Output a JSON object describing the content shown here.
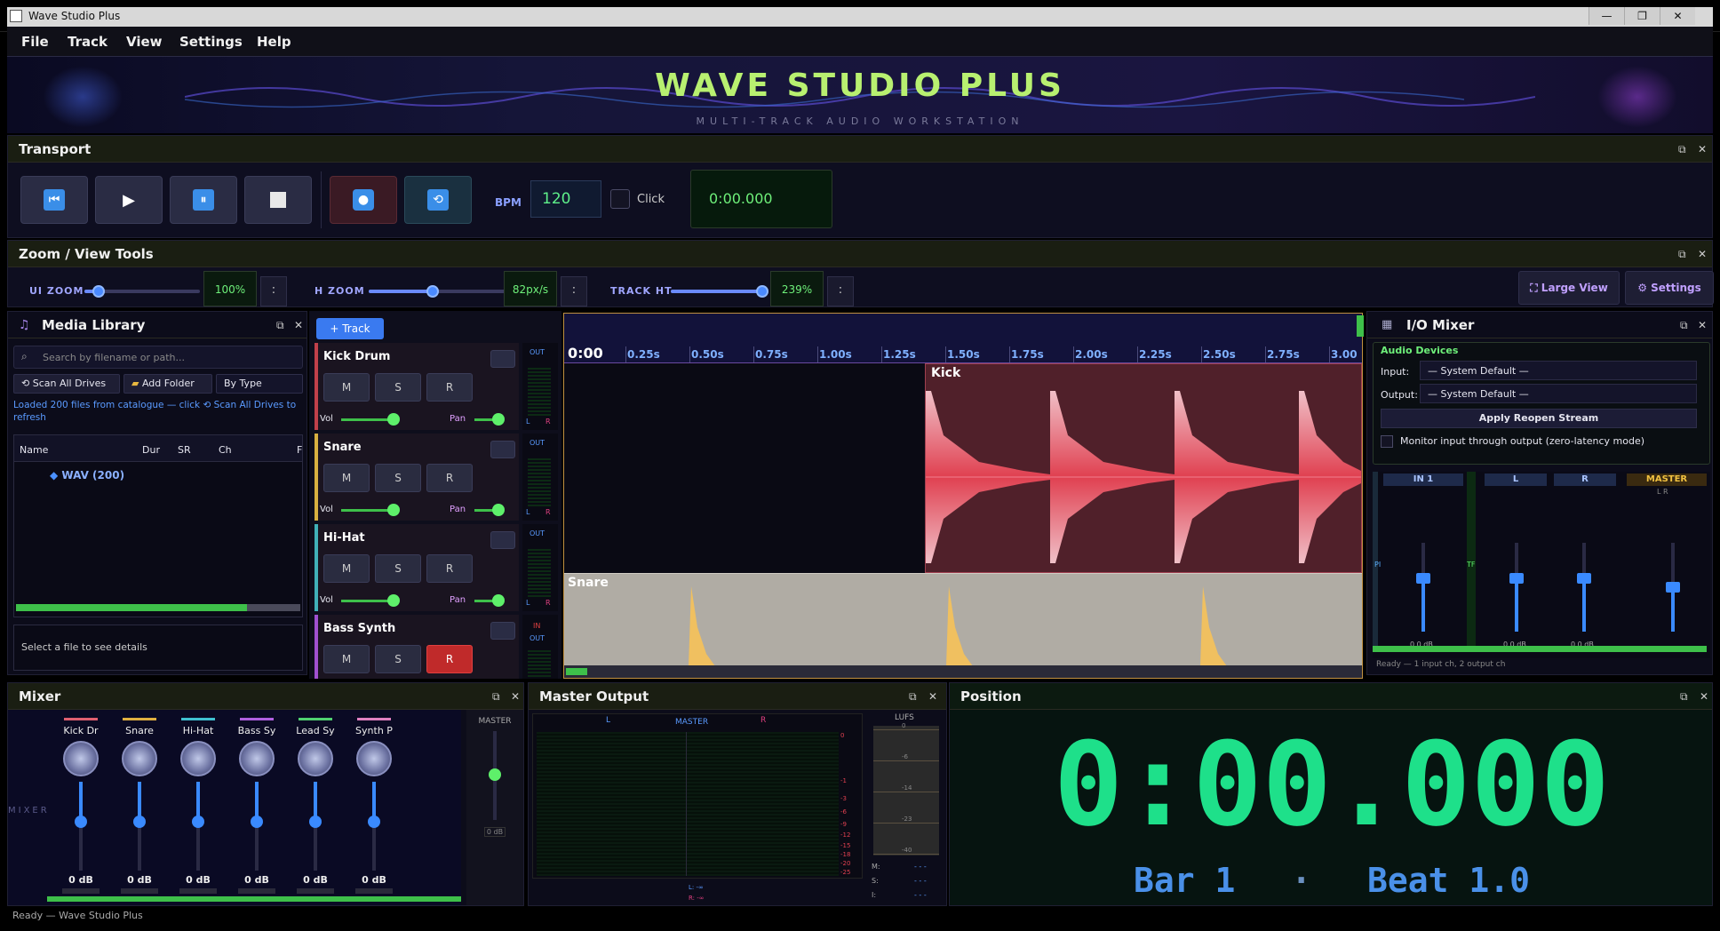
{
  "window": {
    "title": "Wave Studio Plus",
    "controls": [
      "—",
      "❐",
      "✕"
    ]
  },
  "menu": [
    "File",
    "Track",
    "View",
    "Settings",
    "Help"
  ],
  "banner": {
    "title": "WAVE STUDIO PLUS",
    "subtitle": "MULTI-TRACK AUDIO WORKSTATION"
  },
  "transport": {
    "title": "Transport",
    "bpm_label": "BPM",
    "bpm": "120",
    "click_label": "Click",
    "time": "0:00.000"
  },
  "zoom": {
    "title": "Zoom / View Tools",
    "ui_zoom_label": "UI ZOOM",
    "ui_zoom_value": "100%",
    "ui_zoom_level": 0.12,
    "h_zoom_label": "H ZOOM",
    "h_zoom_value": "82px/s",
    "h_zoom_level": 0.45,
    "track_ht_label": "TRACK HT",
    "track_ht_value": "239%",
    "track_ht_level": 0.95,
    "dots": ":",
    "large_view": "Large View",
    "settings": "Settings"
  },
  "media": {
    "title": "Media Library",
    "search_placeholder": "Search by filename or path...",
    "scan_all": "Scan All Drives",
    "add_folder": "Add Folder",
    "sort": "By Type",
    "info": "Loaded 200 files from catalogue — click ⟲ Scan All Drives to refresh",
    "columns": [
      "Name",
      "Dur",
      "SR",
      "Ch",
      "F"
    ],
    "tree_item": "WAV  (200)",
    "details": "Select a file to see details"
  },
  "tracks": {
    "add_track": "+ Track",
    "out": "OUT",
    "in": "IN",
    "items": [
      {
        "name": "Kick Drum",
        "m": "M",
        "s": "S",
        "r": "R",
        "vol": "Vol",
        "pan": "Pan",
        "color": "#c0404a"
      },
      {
        "name": "Snare",
        "m": "M",
        "s": "S",
        "r": "R",
        "vol": "Vol",
        "pan": "Pan",
        "color": "#d8b040"
      },
      {
        "name": "Hi-Hat",
        "m": "M",
        "s": "S",
        "r": "R",
        "vol": "Vol",
        "pan": "Pan",
        "color": "#40b0b8"
      },
      {
        "name": "Bass Synth",
        "m": "M",
        "s": "S",
        "r": "R",
        "vol": "",
        "pan": "",
        "color": "#a050d0"
      }
    ]
  },
  "timeline": {
    "ticks": [
      "0:00",
      "0.25s",
      "0.50s",
      "0.75s",
      "1.00s",
      "1.25s",
      "1.50s",
      "1.75s",
      "2.00s",
      "2.25s",
      "2.50s",
      "2.75s",
      "3.00"
    ],
    "clip_kick": "Kick",
    "clip_snare": "Snare"
  },
  "io_mixer": {
    "title": "I/O Mixer",
    "audio_devices": "Audio Devices",
    "input_label": "Input:",
    "input_value": "— System Default —",
    "output_label": "Output:",
    "output_value": "— System Default —",
    "apply": "Apply  Reopen Stream",
    "monitor": "Monitor input through output (zero-latency mode)",
    "channels": [
      "IN 1",
      "L",
      "R",
      "MASTER"
    ],
    "db": "0.0 dB",
    "status": "Ready — 1 input ch, 2 output ch",
    "lr": "L  R"
  },
  "mixer": {
    "title": "Mixer",
    "side": "MIXER",
    "master": "MASTER",
    "master_db": "0 dB",
    "strips": [
      {
        "name": "Kick Dr",
        "db": "0 dB",
        "color": "#e06070"
      },
      {
        "name": "Snare",
        "db": "0 dB",
        "color": "#e0b040"
      },
      {
        "name": "Hi-Hat",
        "db": "0 dB",
        "color": "#40c0d0"
      },
      {
        "name": "Bass Sy",
        "db": "0 dB",
        "color": "#b060e0"
      },
      {
        "name": "Lead Sy",
        "db": "0 dB",
        "color": "#50d070"
      },
      {
        "name": "Synth P",
        "db": "0 dB",
        "color": "#e080c0"
      }
    ]
  },
  "master_output": {
    "title": "Master Output",
    "l": "L",
    "master": "MASTER",
    "r": "R",
    "scale": [
      "0",
      "-1",
      "-3",
      "-6",
      "-9",
      "-12",
      "-15",
      "-18",
      "-20",
      "-25"
    ],
    "lufs": "LUFS",
    "lufs_scale": [
      "0",
      "-6",
      "-14",
      "-23",
      "-40"
    ],
    "m": "M:",
    "s": "S:",
    "i": "I:",
    "dash": "- - -",
    "peak_l": "L: -∞",
    "peak_r": "R: -∞"
  },
  "position": {
    "title": "Position",
    "time": "0:00.000",
    "bar": "Bar 1",
    "dot": "·",
    "beat": "Beat 1.0"
  },
  "status": "Ready — Wave Studio Plus"
}
